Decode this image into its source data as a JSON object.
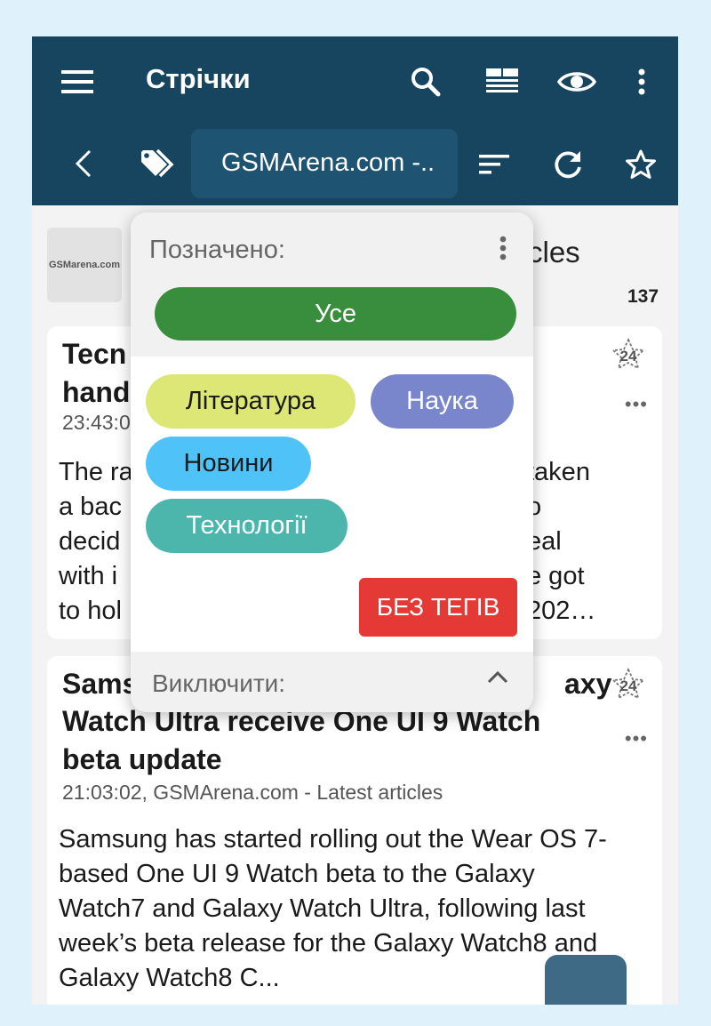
{
  "toolbar": {
    "title": "Стрічки",
    "feed_selector": "GSMArena.com -..",
    "icons": [
      "menu-icon",
      "search-icon",
      "view-mode-icon",
      "eye-icon",
      "overflow-menu-icon",
      "back-icon",
      "tags-icon",
      "sort-icon",
      "refresh-icon",
      "star-icon"
    ]
  },
  "feed": {
    "logo_text": "GSMarena.com",
    "title_tail": "cles",
    "count": "137"
  },
  "articles": [
    {
      "title": "Tecn\nhand",
      "meta": "23:43:0",
      "body": "The ra\na bac\ndecid\nwith i\nto hol",
      "body_right": "taken\no\neal\ne got\n202…",
      "badge": "24"
    },
    {
      "title_head": "Sams",
      "title_tail": "axy",
      "title_rest": "Watch Ultra receive One UI 9 Watch\nbeta update",
      "meta": "21:03:02, GSMArena.com - Latest articles",
      "body": "Samsung has started rolling out the Wear OS 7-based One UI 9 Watch beta to the Galaxy Watch7 and Galaxy Watch Ultra, following last week’s beta release for the Galaxy Watch8 and Galaxy Watch8 C...",
      "badge": "24"
    }
  ],
  "tag_popup": {
    "included_label": "Позначено:",
    "all_button": "Усе",
    "tags": [
      {
        "name": "Література",
        "color": "#dce775",
        "text_color": "#1a1a1a"
      },
      {
        "name": "Наука",
        "color": "#7986cb",
        "text_color": "#ffffff"
      },
      {
        "name": "Новини",
        "color": "#4fc3f7",
        "text_color": "#1a1a1a"
      },
      {
        "name": "Технології",
        "color": "#4db6ac",
        "text_color": "#ffffff"
      }
    ],
    "no_tags_button": "БЕЗ ТЕГІВ",
    "excluded_label": "Виключити:"
  },
  "colors": {
    "toolbar": "#17445f",
    "accent_green": "#388e3c",
    "danger_red": "#e53935",
    "fab": "#2f5e7b"
  }
}
